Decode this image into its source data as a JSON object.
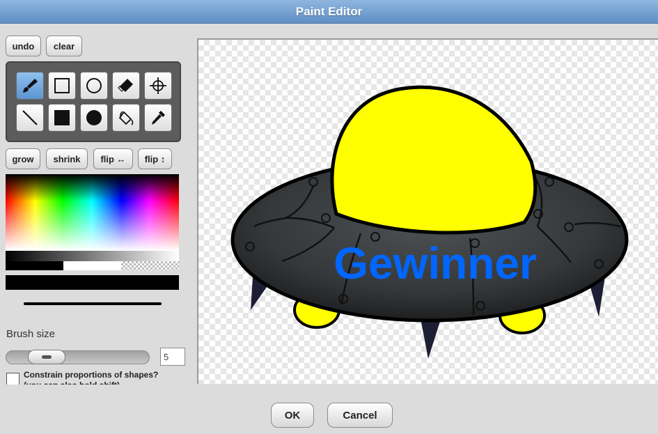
{
  "window": {
    "title": "Paint Editor"
  },
  "top_buttons": {
    "undo": "undo",
    "clear": "clear"
  },
  "tools": [
    {
      "name": "paintbrush-icon",
      "selected": true
    },
    {
      "name": "rectangle-icon",
      "selected": false
    },
    {
      "name": "ellipse-icon",
      "selected": false
    },
    {
      "name": "eraser-icon",
      "selected": false
    },
    {
      "name": "crosshair-icon",
      "selected": false
    },
    {
      "name": "line-icon",
      "selected": false
    },
    {
      "name": "filled-rectangle-icon",
      "selected": false
    },
    {
      "name": "filled-ellipse-icon",
      "selected": false
    },
    {
      "name": "paint-bucket-icon",
      "selected": false
    },
    {
      "name": "eyedropper-icon",
      "selected": false
    }
  ],
  "transform_buttons": {
    "grow": "grow",
    "shrink": "shrink",
    "flip_h": "flip ↔",
    "flip_v": "flip ↕"
  },
  "color": {
    "current": "#000000",
    "selected_tool_color": "#5b95d1"
  },
  "brush": {
    "label": "Brush size",
    "size": "5",
    "slider_fraction": 0.27
  },
  "constrain": {
    "line1": "Constrain proportions of shapes?",
    "line2": "(you can also hold shift)",
    "checked": false
  },
  "canvas": {
    "text": "Gewinner",
    "text_color": "#0066ff",
    "dome_color": "#ffff00",
    "body_color": "#2f3133"
  },
  "dialog": {
    "ok": "OK",
    "cancel": "Cancel"
  }
}
